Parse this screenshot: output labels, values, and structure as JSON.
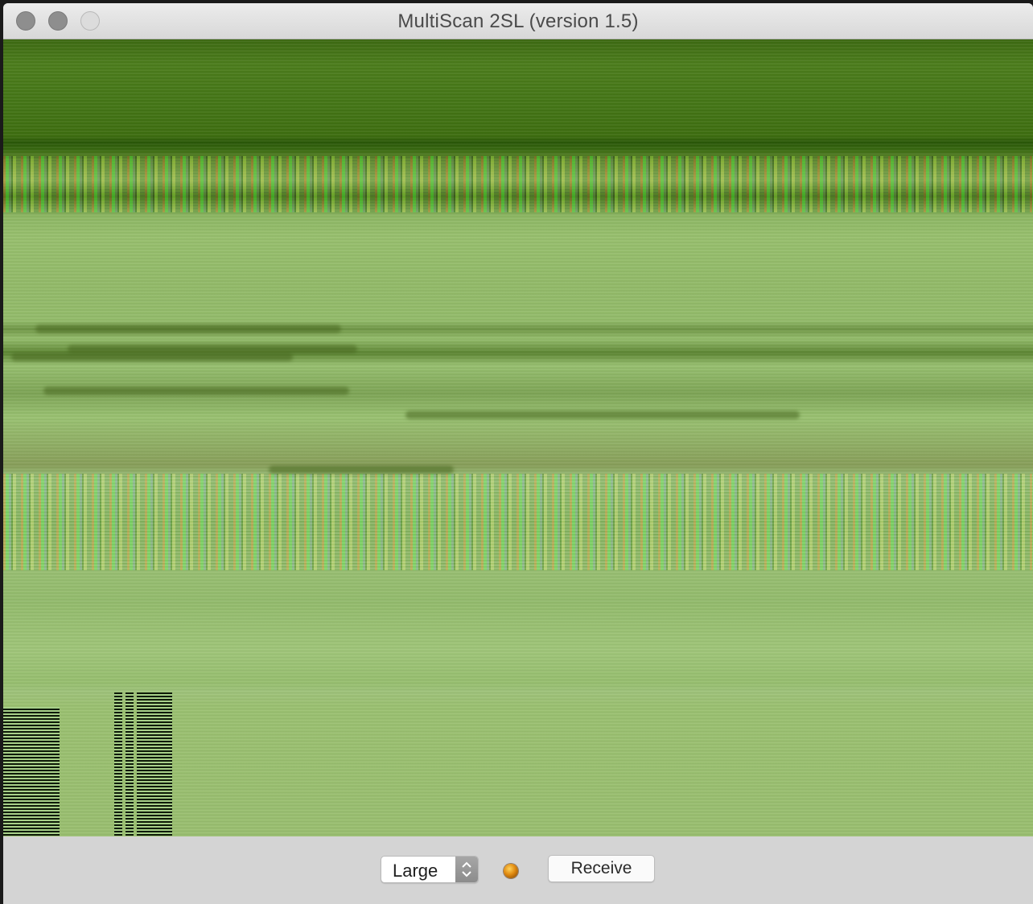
{
  "window": {
    "title": "MultiScan 2SL (version 1.5)"
  },
  "toolbar": {
    "size_select": {
      "value": "Large"
    },
    "status_led": {
      "color": "#e08a10"
    },
    "receive_label": "Receive"
  }
}
